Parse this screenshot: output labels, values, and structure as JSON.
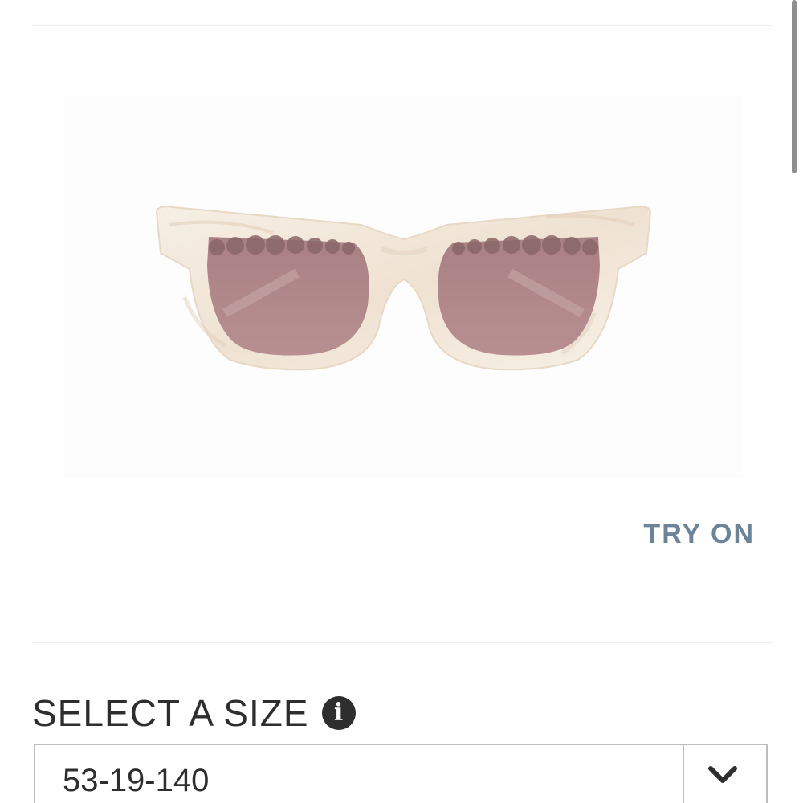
{
  "product": {
    "image_alt": "Ivory marbled cat-eye sunglasses with pink lenses and pearl-studded temples",
    "colors": {
      "frame": "#f3e9dc",
      "lens": "#b48a8c",
      "accent_text": "#6b8499",
      "heading_text": "#2e2e2e"
    }
  },
  "actions": {
    "try_on_label": "TRY ON"
  },
  "size": {
    "heading": "SELECT A SIZE",
    "info_icon": "info-icon",
    "selected_value": "53-19-140",
    "dropdown_icon": "chevron-down-icon"
  }
}
